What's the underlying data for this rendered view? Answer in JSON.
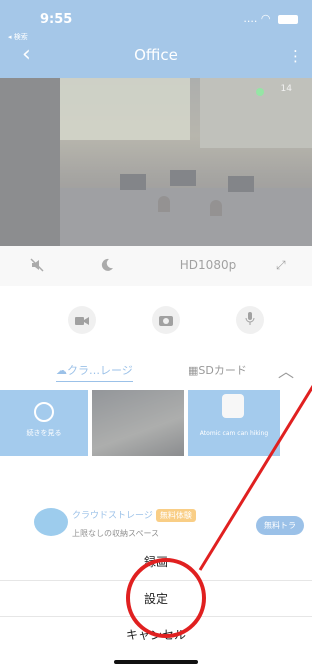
{
  "status_bar": {
    "time": "9:55",
    "back_label": "◂ 検索",
    "signal": "....",
    "wifi": "wifi-icon"
  },
  "nav": {
    "title": "Office",
    "back_icon": "chevron-left-icon",
    "more_icon": "more-vertical-icon"
  },
  "video": {
    "overlay_text": "14"
  },
  "video_toolbar": {
    "mute_icon": "speaker-mute-icon",
    "night_icon": "moon-icon",
    "quality": "HD1080p",
    "fullscreen_icon": "expand-icon"
  },
  "actions": [
    {
      "name": "record",
      "icon": "video-camera-icon"
    },
    {
      "name": "snapshot",
      "icon": "camera-icon"
    },
    {
      "name": "talk",
      "icon": "microphone-icon"
    }
  ],
  "tabs": {
    "cloud": "クラ…レージ",
    "sd": "SDカード"
  },
  "thumbnails": {
    "more_label": "続きを見る",
    "third_caption": "Atomic cam can hiking"
  },
  "promo": {
    "title": "クラウドストレージ",
    "badge": "無料体験",
    "subtitle": "上限なしの収納スペース",
    "button": "無料トラ"
  },
  "sheet": {
    "record": "録画",
    "settings": "設定",
    "cancel": "キャンセル"
  },
  "colors": {
    "accent": "#5b9ad6",
    "annotation": "#e02020",
    "promo_badge": "#f5a623"
  }
}
